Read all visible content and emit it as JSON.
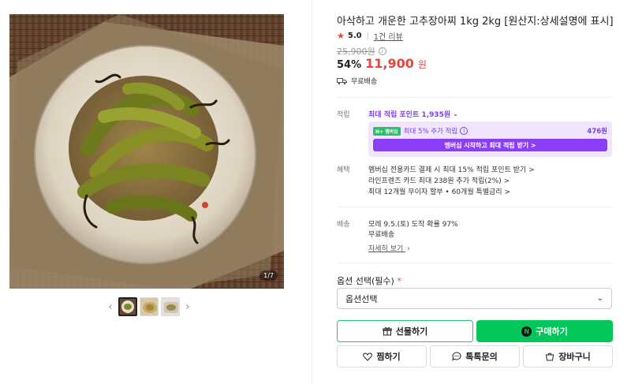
{
  "product": {
    "title": "아삭하고 개운한 고추장아찌 1kg 2kg [원산지:상세설명에 표시]",
    "rating": "5.0",
    "review_count": "1건 리뷰",
    "original_price": "25,900원",
    "discount": "54%",
    "sale_price": "11,900",
    "sale_unit": "원",
    "shipping_free": "무료배송",
    "photo_counter": "1/7"
  },
  "points": {
    "label": "적립",
    "max_point": "최대 적립 포인트 1,935원",
    "member_badge": "N+ 멤버십",
    "member_text": "최대 5% 추가 적립",
    "member_amount": "476원",
    "member_button": "멤버십 시작하고 최대 적립 받기 >"
  },
  "benefits": {
    "label": "혜택",
    "lines": [
      "멤버십 전용카드 결제 시 최대 15% 적립 포인트 받기 >",
      "라인프렌즈 카드 최대 238원 추가 적립(2%) >",
      "최대 12개월 무이자 할부 • 60개월 특별금리 >"
    ]
  },
  "delivery": {
    "label": "배송",
    "arrival": "모레 9.5.(토) 도착 확률 97%",
    "fee": "무료배송",
    "details_link": "자세히 보기"
  },
  "option": {
    "label": "옵션 선택(필수)",
    "required_mark": "*",
    "select_value": "옵션선택"
  },
  "buttons": {
    "gift": "선물하기",
    "buy": "구매하기",
    "wish": "찜하기",
    "talk": "톡톡문의",
    "cart": "장바구니"
  },
  "colors": {
    "accent_green": "#03c75a",
    "price_red": "#e9453d",
    "point_purple": "#7b3ff2"
  }
}
